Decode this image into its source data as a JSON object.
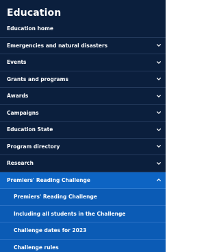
{
  "nav": {
    "title": "Education",
    "home": "Education home",
    "items": [
      {
        "label": "Emergencies and natural disasters"
      },
      {
        "label": "Events"
      },
      {
        "label": "Grants and programs"
      },
      {
        "label": "Awards"
      },
      {
        "label": "Campaigns"
      },
      {
        "label": "Education State"
      },
      {
        "label": "Program directory"
      },
      {
        "label": "Research"
      }
    ],
    "active": {
      "label": "Premiers' Reading Challenge",
      "children": [
        {
          "label": "Premiers' Reading Challenge"
        },
        {
          "label": "Including all students in the Challenge"
        },
        {
          "label": "Challenge dates for 2023"
        },
        {
          "label": "Challenge rules"
        }
      ]
    }
  },
  "colors": {
    "nav_bg": "#0b1f3d",
    "active_bg": "#0d64c3",
    "text": "#ffffff"
  },
  "icons": {
    "collapsed": "chevron-down-icon",
    "expanded": "chevron-up-icon"
  }
}
